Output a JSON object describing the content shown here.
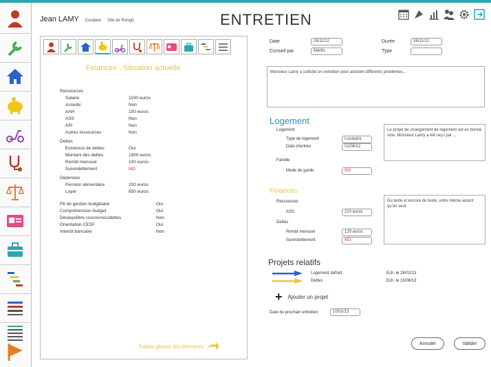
{
  "header": {
    "user_name": "Jean LAMY",
    "user_role": "Curateur",
    "user_site": "Site de Rungis",
    "title": "ENTRETIEN"
  },
  "top_icons": [
    "calendar-icon",
    "pen-nib-icon",
    "chart-icon",
    "people-icon",
    "settings-gear-icon",
    "logout-icon"
  ],
  "left_nav": [
    "user-icon",
    "wrench-icon",
    "home-icon",
    "piggy-bank-icon",
    "scooter-icon",
    "stethoscope-icon",
    "scales-icon",
    "id-card-icon",
    "briefcase-icon",
    "gantt-icon",
    "list-icon",
    "list-detail-icon",
    "flag-icon"
  ],
  "tabs": [
    "user-icon",
    "wrench-icon",
    "home-icon",
    "piggy-bank-icon",
    "scooter-icon",
    "stethoscope-icon",
    "scales-icon",
    "id-card-icon",
    "briefcase-icon",
    "gantt-icon",
    "menu-icon"
  ],
  "finances": {
    "title": "Finances : Situation actuelle",
    "ressources_label": "Ressources",
    "ressources": [
      {
        "label": "Salaire",
        "value": "1100 euros"
      },
      {
        "label": "Assedic",
        "value": "Non"
      },
      {
        "label": "AAH",
        "value": "150 euros"
      },
      {
        "label": "ASS",
        "value": "Non"
      },
      {
        "label": "API",
        "value": "Non"
      },
      {
        "label": "Autres ressources",
        "value": "Non"
      }
    ],
    "dettes_label": "Dettes",
    "dettes": [
      {
        "label": "Existence de dettes",
        "value": "Oui"
      },
      {
        "label": "Montant des dettes",
        "value": "1900 euros"
      },
      {
        "label": "Rembt mensuel",
        "value": "100 euros"
      },
      {
        "label": "Surendettement",
        "value": "NO"
      }
    ],
    "depenses_label": "Depenses",
    "depenses": [
      {
        "label": "Pension alimentaire",
        "value": "200 euros"
      },
      {
        "label": "Loyer",
        "value": "650 euros"
      }
    ],
    "autres": [
      {
        "label": "Pb de gestion budgétaire",
        "value": "Oui"
      },
      {
        "label": "Compréhension budget",
        "value": "Oui"
      },
      {
        "label": "Déséquilibre ressources/dettes",
        "value": "Non"
      },
      {
        "label": "Orientation CESF",
        "value": "Oui"
      },
      {
        "label": "Interdit bancaire",
        "value": "Non"
      }
    ],
    "footer_link": "Faites glisser les éléments"
  },
  "form": {
    "date_label": "Date",
    "date_value": "26/11/12",
    "duree_label": "Durée",
    "duree_value": "26/11/12",
    "conseil_label": "Conseil par",
    "conseil_value": "Martin",
    "type_label": "Type",
    "type_value": "",
    "notes": "Monsieur Lamy a sollicité un entretien pour aborder différents problèmes..."
  },
  "logement": {
    "title": "Logement",
    "group_label": "Logement",
    "type_label": "Type de logement",
    "type_value": "Locataire",
    "date_label": "Date d'entrée",
    "date_value": "01/08/12",
    "famille_label": "Famille",
    "garde_label": "Mode de garde",
    "garde_value": "NO",
    "notes": "Le projet de changement de logement est en bonne voie. Monsieur Lamy a été reçu par ..."
  },
  "finances_right": {
    "title": "Finances",
    "ressources_label": "Ressources",
    "ass_label": "ASS",
    "ass_value": "210 euros",
    "dettes_label": "Dettes",
    "rembt_label": "Rembt mensuel",
    "rembt_value": "120 euros",
    "surendet_label": "Surendettement",
    "surendet_value": "NO",
    "notes": "Du texte et encore du texte, votre même autant qu'on veut"
  },
  "projets": {
    "title": "Projets relatifs",
    "items": [
      {
        "label": "Logement défraît",
        "date": "Ech. le 28/02/13",
        "color": "#2a62c8"
      },
      {
        "label": "Dettes",
        "date": "Ech. le 15/06/13",
        "color": "#e8c64a"
      }
    ],
    "add_label": "Ajouter un projet",
    "next_label": "Date du prochain entretien",
    "next_value": "10/01/13"
  },
  "buttons": {
    "annuler": "Annuler",
    "valider": "Valider"
  },
  "colors": {
    "accent": "#2aa7b0",
    "yellow": "#e8c64a",
    "teal_heading": "#2a8fb8",
    "red_value": "#d83030"
  }
}
